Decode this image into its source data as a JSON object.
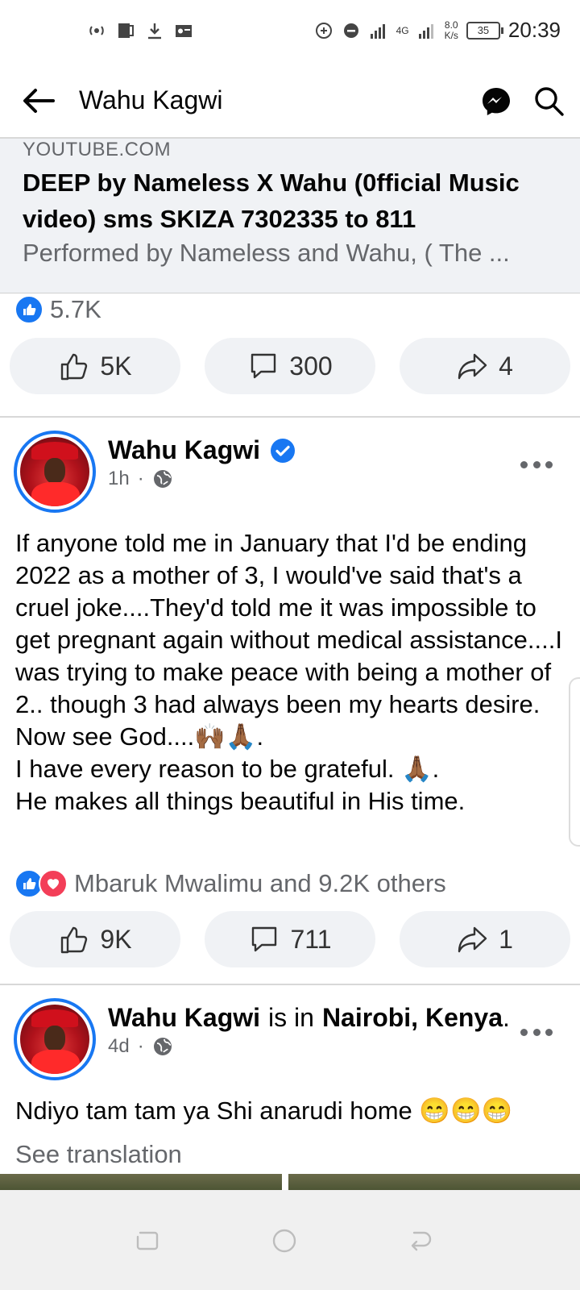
{
  "status_bar": {
    "time": "20:39",
    "speed_value": "8.0",
    "speed_unit": "K/s",
    "network": "4G",
    "battery": "35"
  },
  "app_bar": {
    "title": "Wahu Kagwi"
  },
  "link_preview": {
    "domain": "YOUTUBE.COM",
    "title": "DEEP by Nameless X Wahu (0fficial Music video) sms SKIZA 7302335 to 811",
    "description": "Performed by Nameless and Wahu, ( The ..."
  },
  "post1": {
    "reaction_count": "5.7K",
    "like_count": "5K",
    "comment_count": "300",
    "share_count": "4"
  },
  "post2": {
    "author": "Wahu Kagwi",
    "time": "1h",
    "text_lines": [
      "If anyone told me in January that I'd be ending 2022 as a mother of 3, I would've said that's a cruel joke....They'd told me it was impossible to get pregnant again without medical assistance....I was trying to make peace with being a mother of 2.. though 3 had always been my hearts desire. Now see God....🙌🏾🙏🏾.",
      "I have every reason to be grateful. 🙏🏾.",
      "He makes all things beautiful in His time."
    ],
    "reactions_text": "Mbaruk Mwalimu and 9.2K others",
    "like_count": "9K",
    "comment_count": "711",
    "share_count": "1"
  },
  "post3": {
    "author": "Wahu Kagwi",
    "is_in": "is in",
    "location": "Nairobi, Kenya",
    "time": "4d",
    "text": "Ndiyo tam tam ya Shi anarudi home 😁😁😁",
    "see_translation": "See translation"
  },
  "colors": {
    "brand_blue": "#1877f2",
    "love_red": "#f33e58",
    "secondary_text": "#65676b",
    "button_bg": "#f0f2f5"
  }
}
